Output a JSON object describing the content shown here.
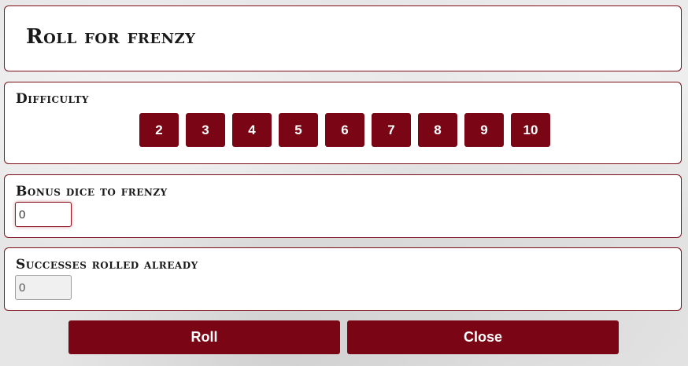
{
  "dialog": {
    "title": "Roll for frenzy"
  },
  "difficulty": {
    "label": "Difficulty",
    "options": [
      "2",
      "3",
      "4",
      "5",
      "6",
      "7",
      "8",
      "9",
      "10"
    ]
  },
  "bonus_dice": {
    "label": "Bonus dice to frenzy",
    "value": "0"
  },
  "successes": {
    "label": "Successes rolled already",
    "value": "0"
  },
  "actions": {
    "roll_label": "Roll",
    "close_label": "Close"
  },
  "colors": {
    "accent": "#7a0615",
    "border": "#7a0f1a",
    "panel_bg": "#ffffff"
  }
}
